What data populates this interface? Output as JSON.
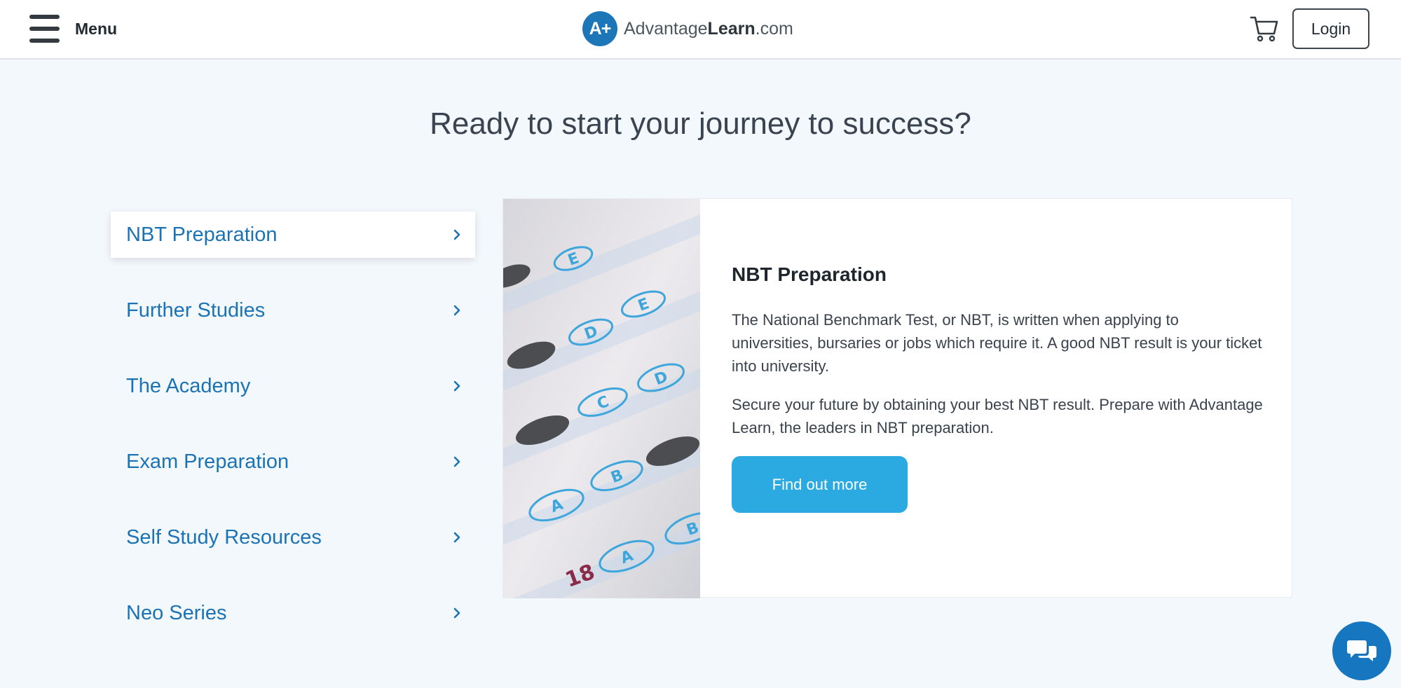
{
  "header": {
    "menu_label": "Menu",
    "logo_badge": "A+",
    "logo_text_pre": "Advantage",
    "logo_text_strong": "Learn",
    "logo_text_post": ".com",
    "login_label": "Login"
  },
  "hero": {
    "title": "Ready to start your journey to success?"
  },
  "nav": {
    "items": [
      {
        "label": "NBT Preparation",
        "active": true
      },
      {
        "label": "Further Studies",
        "active": false
      },
      {
        "label": "The Academy",
        "active": false
      },
      {
        "label": "Exam Preparation",
        "active": false
      },
      {
        "label": "Self Study Resources",
        "active": false
      },
      {
        "label": "Neo Series",
        "active": false
      }
    ]
  },
  "card": {
    "title": "NBT Preparation",
    "paragraphs": [
      "The National Benchmark Test, or NBT, is written when applying to universities, bursaries or jobs which require it. A good NBT result is your ticket into university.",
      "Secure your future by obtaining your best NBT result. Prepare with Advantage Learn, the leaders in NBT preparation."
    ],
    "cta_label": "Find out more",
    "image_marks": [
      "E",
      "E",
      "D",
      "D",
      "C",
      "B",
      "A",
      "A",
      "B",
      "18"
    ]
  },
  "icons": {
    "menu": "hamburger-icon",
    "cart": "cart-icon",
    "chevron": "chevron-right-icon",
    "chat": "chat-icon"
  },
  "colors": {
    "brand_blue": "#1c76b7",
    "link_blue": "#1c73b4",
    "cta_blue": "#2ba9e1",
    "background": "#f3f8fc"
  }
}
